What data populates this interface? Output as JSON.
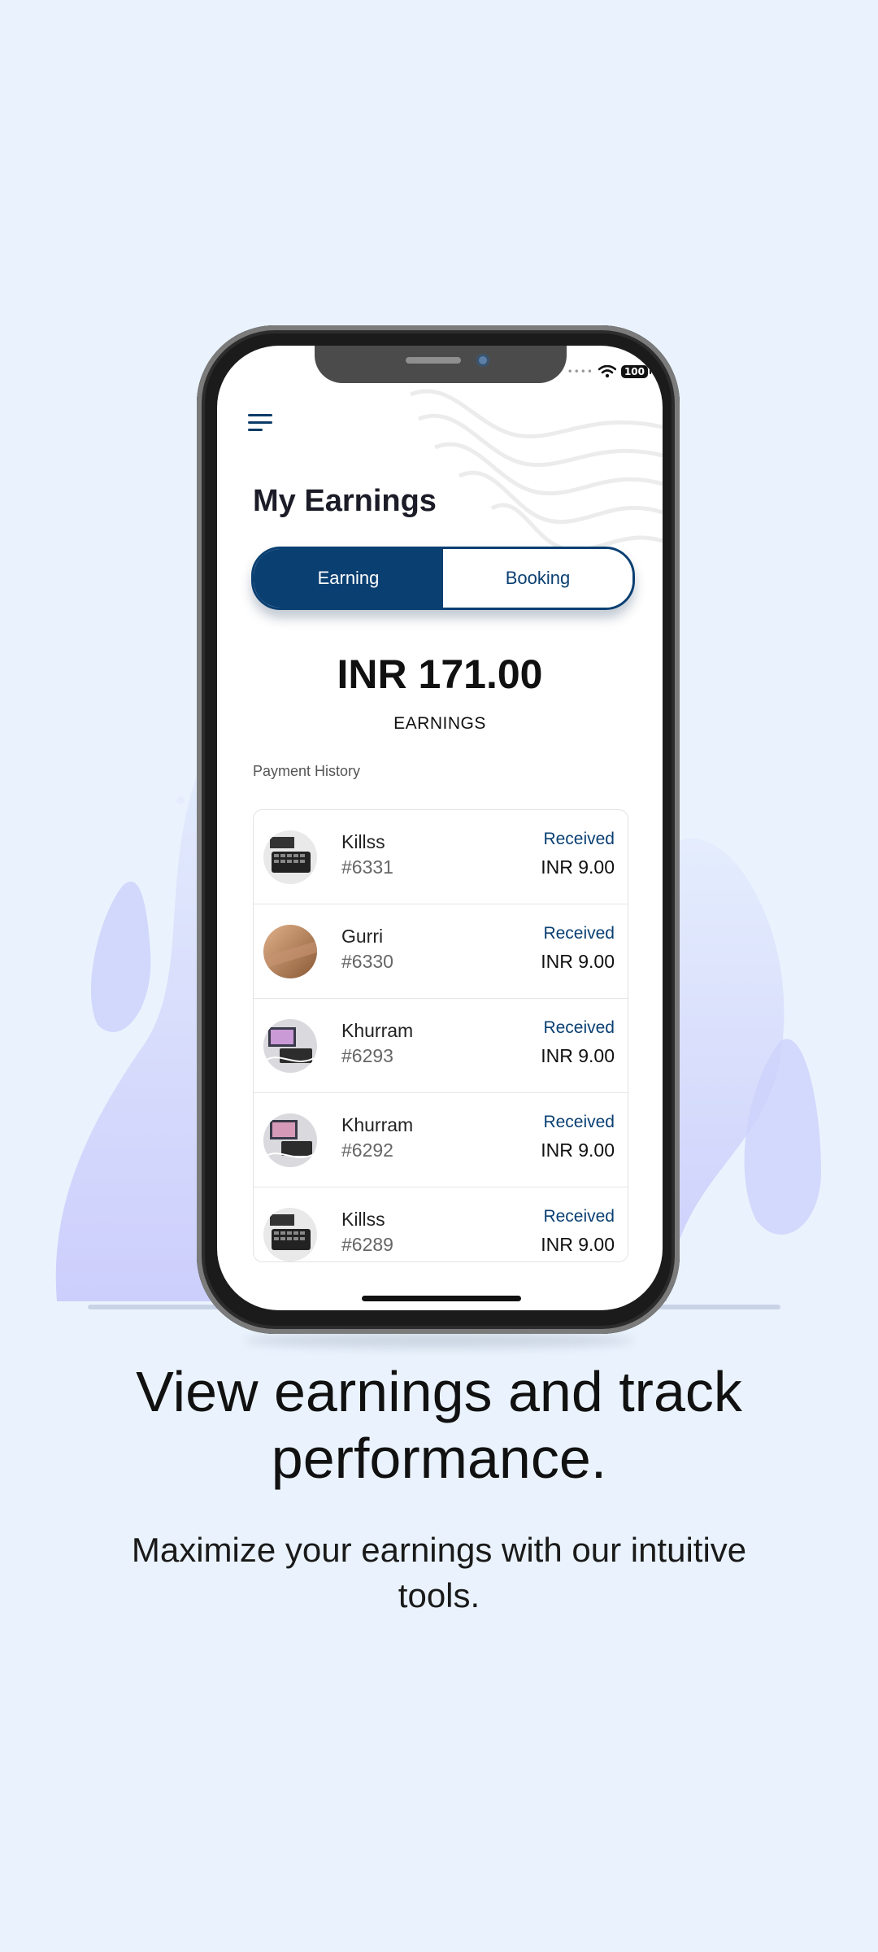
{
  "colors": {
    "background": "#eaf3fd",
    "brand_navy": "#0a3f72",
    "blob": "#c9ccfb"
  },
  "status_bar": {
    "battery": "100",
    "icons": [
      "signal-dots-icon",
      "wifi-icon",
      "battery-icon"
    ]
  },
  "header": {
    "menu_icon": "hamburger-menu-icon",
    "title": "My Earnings"
  },
  "tabs": [
    {
      "label": "Earning",
      "active": true
    },
    {
      "label": "Booking",
      "active": false
    }
  ],
  "summary": {
    "amount": "INR 171.00",
    "label": "EARNINGS"
  },
  "history": {
    "title": "Payment History",
    "items": [
      {
        "name": "Killss",
        "id": "#6331",
        "status": "Received",
        "amount": "INR 9.00"
      },
      {
        "name": "Gurri",
        "id": "#6330",
        "status": "Received",
        "amount": "INR 9.00"
      },
      {
        "name": "Khurram",
        "id": "#6293",
        "status": "Received",
        "amount": "INR 9.00"
      },
      {
        "name": "Khurram",
        "id": "#6292",
        "status": "Received",
        "amount": "INR 9.00"
      },
      {
        "name": "Killss",
        "id": "#6289",
        "status": "Received",
        "amount": "INR 9.00"
      }
    ]
  },
  "promo": {
    "headline": "View earnings and track performance.",
    "subline": "Maximize your earnings with our intuitive tools."
  }
}
